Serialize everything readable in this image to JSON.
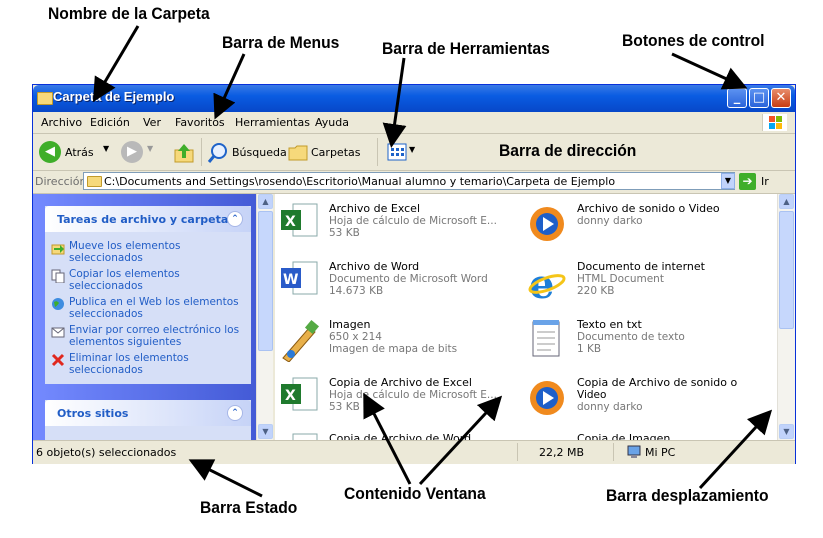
{
  "annotations": {
    "folder_name": "Nombre de la Carpeta",
    "menu_bar": "Barra de Menus",
    "toolbar": "Barra de Herramientas",
    "control_buttons": "Botones de control",
    "address_bar": "Barra de dirección",
    "status_bar": "Barra Estado",
    "window_content": "Contenido Ventana",
    "scroll_bar": "Barra desplazamiento"
  },
  "window": {
    "title": "Carpeta de Ejemplo"
  },
  "menu": [
    "Archivo",
    "Edición",
    "Ver",
    "Favoritos",
    "Herramientas",
    "Ayuda"
  ],
  "toolbar": {
    "back": "Atrás",
    "search": "Búsqueda",
    "folders": "Carpetas"
  },
  "address": {
    "label": "Dirección",
    "path": "C:\\Documents and Settings\\rosendo\\Escritorio\\Manual alumno y temario\\Carpeta de Ejemplo",
    "go": "Ir"
  },
  "left_pane": {
    "file_tasks_title": "Tareas de archivo y carpeta",
    "tasks": [
      {
        "label": "Mueve los elementos seleccionados",
        "icon": "move-icon"
      },
      {
        "label": "Copiar los elementos seleccionados",
        "icon": "copy-icon"
      },
      {
        "label": "Publica en el Web los elementos seleccionados",
        "icon": "globe-icon"
      },
      {
        "label": "Enviar por correo electrónico los elementos siguientes",
        "icon": "mail-icon"
      },
      {
        "label": "Eliminar los elementos seleccionados",
        "icon": "delete-icon"
      }
    ],
    "other_places_title": "Otros sitios"
  },
  "files": [
    {
      "name": "Archivo de Excel",
      "line2": "Hoja de cálculo de Microsoft E...",
      "line3": "53 KB",
      "icon": "excel-icon"
    },
    {
      "name": "Archivo de sonido o Video",
      "line2": "donny darko",
      "line3": "",
      "icon": "media-player-icon"
    },
    {
      "name": "Archivo de Word",
      "line2": "Documento de Microsoft Word",
      "line3": "14.673 KB",
      "icon": "word-icon"
    },
    {
      "name": "Documento de internet",
      "line2": "HTML Document",
      "line3": "220 KB",
      "icon": "internet-explorer-icon"
    },
    {
      "name": "Imagen",
      "line2": "650 x 214",
      "line3": "Imagen de mapa de bits",
      "icon": "paint-icon"
    },
    {
      "name": "Texto en txt",
      "line2": "Documento de texto",
      "line3": "1 KB",
      "icon": "notepad-icon"
    },
    {
      "name": "Copia de Archivo de Excel",
      "line2": "Hoja de cálculo de Microsoft E...",
      "line3": "53 KB",
      "icon": "excel-icon"
    },
    {
      "name": "Copia de Archivo de sonido o",
      "line2": "Video",
      "line3": "donny darko",
      "icon": "media-player-icon"
    },
    {
      "name": "Copia de Archivo de Word",
      "line2": "",
      "line3": "",
      "icon": "word-icon"
    },
    {
      "name": "Copia de Imagen",
      "line2": "",
      "line3": "",
      "icon": "paint-icon"
    }
  ],
  "status": {
    "selected": "6 objeto(s) seleccionados",
    "size": "22,2 MB",
    "location": "Mi PC"
  }
}
